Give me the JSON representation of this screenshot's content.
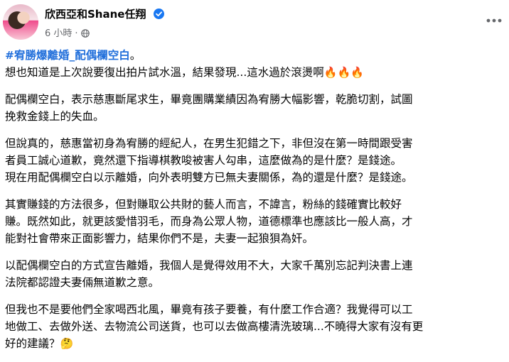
{
  "post": {
    "author": "欣西亞和Shane任翔",
    "time": "6 小時",
    "separator": "·",
    "icons": {
      "verified": "verified-badge-icon",
      "audience": "globe-icon",
      "more": "more-horizontal-icon"
    },
    "accent_color": "#216fdb",
    "hashtag": "#宥勝爆離婚_配偶欄空白",
    "hashtag_tail": "。",
    "line1": "想也知道是上次說要復出拍片試水溫，結果發現...這水過於滾燙啊",
    "line1_emoji": "🔥🔥🔥",
    "para2": [
      "配偶欄空白，表示慈惠斷尾求生，畢竟團購業績因為宥勝大幅影響，乾脆切割，試圖",
      "挽救金錢上的失血。"
    ],
    "para3": [
      "但說真的，慈惠當初身為宥勝的經紀人，在男生犯錯之下，非但沒在第一時間跟受害",
      "者員工誠心道歉，竟然還下指導棋教唆被害人勾串，這麼做為的是什麼？是錢途。",
      "現在用配偶欄空白以示離婚，向外表明雙方已無夫妻關係，為的還是什麼？是錢途。"
    ],
    "para4": [
      "其實賺錢的方法很多，但對賺取公共財的藝人而言，不諱言，粉絲的錢確實比較好",
      "賺。既然如此，就更該愛惜羽毛，而身為公眾人物，道德標準也應該比一般人高，才",
      "能對社會帶來正面影響力，結果你們不是，夫妻一起狼狽為奸。"
    ],
    "para5": [
      "以配偶欄空白的方式宣告離婚，我個人是覺得效用不大，大家千萬別忘記判決書上連",
      "法院都認證夫妻倆無道歉之意。"
    ],
    "para6": [
      "但我也不是要他們全家喝西北風，畢竟有孩子要養，有什麼工作合適？我覺得可以工",
      "地做工、去做外送、去物流公司送貨，也可以去做高樓清洗玻璃...不曉得大家有沒有更"
    ],
    "para6_last": "好的建議？",
    "para6_emoji": "🤔"
  }
}
